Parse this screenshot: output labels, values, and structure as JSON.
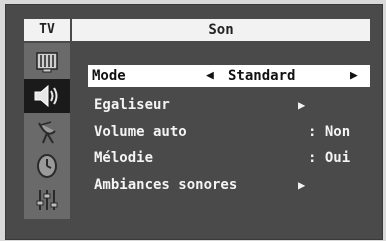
{
  "header": {
    "source_label": "TV",
    "title": "Son"
  },
  "sidebar": {
    "icons": [
      "picture-icon",
      "sound-icon",
      "channel-icon",
      "clock-icon",
      "setup-icon"
    ],
    "active_index": 1
  },
  "menu": {
    "items": [
      {
        "label": "Mode",
        "value": "Standard",
        "left_arrow": "◀",
        "right_arrow": "▶"
      },
      {
        "label": "Egaliseur",
        "arrow": "▶"
      },
      {
        "label": "Volume auto",
        "value": ": Non"
      },
      {
        "label": "Mélodie",
        "value": ": Oui"
      },
      {
        "label": "Ambiances sonores",
        "arrow": "▶"
      }
    ]
  }
}
